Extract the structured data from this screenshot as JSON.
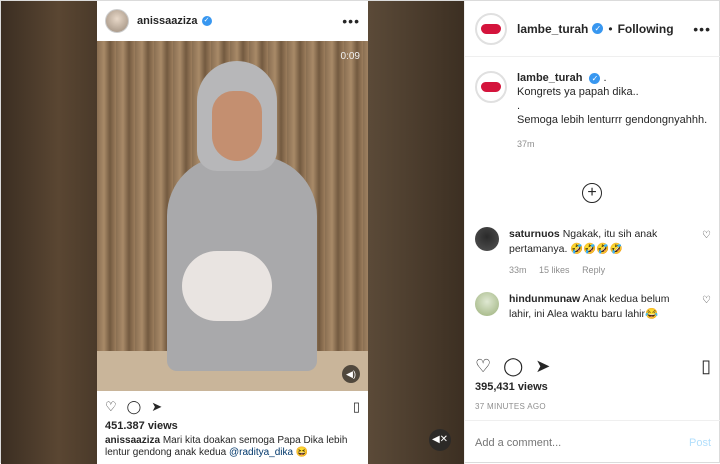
{
  "inner_post": {
    "username": "anissaaziza",
    "timecode": "0:09",
    "views": "451.387 views",
    "caption_user": "anissaaziza",
    "caption_text": "Mari kita doakan semoga Papa Dika lebih lentur gendong anak kedua",
    "caption_mention": "@raditya_dika",
    "caption_emoji": "😆"
  },
  "post": {
    "username": "lambe_turah",
    "follow_status": "Following",
    "separator": "•",
    "caption_user": "lambe_turah",
    "caption_suffix": ".",
    "caption_lines": [
      "Kongrets ya papah dika..",
      ".",
      "Semoga lebih lenturrr gendongnyahhh."
    ],
    "time": "37m",
    "load_more": "+"
  },
  "comments": [
    {
      "username": "saturnuos",
      "text": "Ngakak, itu sih anak pertamanya. 🤣🤣🤣🤣",
      "time": "33m",
      "likes": "15 likes",
      "reply": "Reply"
    },
    {
      "username": "hindunmunaw",
      "text": "Anak kedua belum lahir, ini Alea waktu baru lahir😂"
    }
  ],
  "stats": {
    "likes": "395,431 views",
    "posted": "37 MINUTES AGO"
  },
  "comment_box": {
    "placeholder": "Add a comment...",
    "post_label": "Post"
  },
  "colors": {
    "accent": "#3897f0",
    "post_disabled": "#b2dffc",
    "brand_lips": "#d4143c"
  }
}
